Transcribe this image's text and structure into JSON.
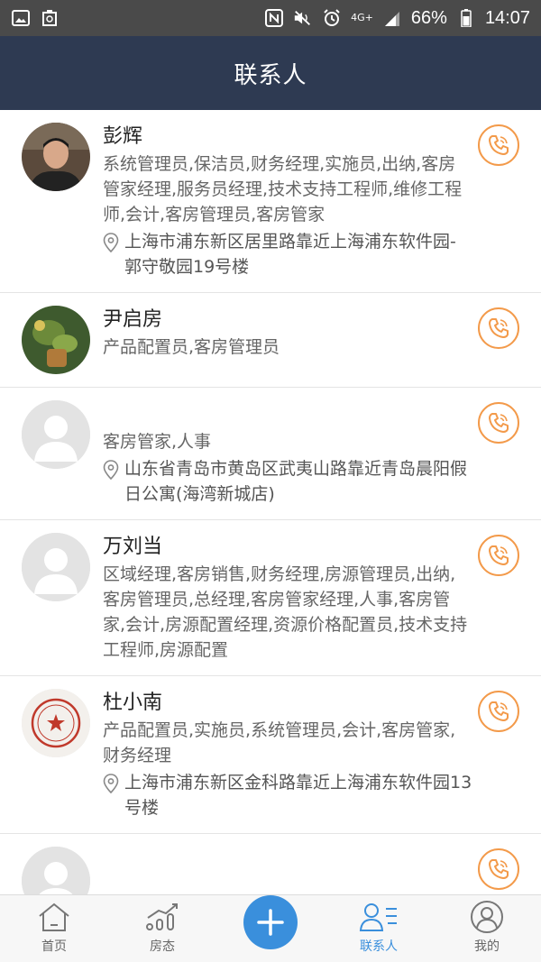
{
  "status_bar": {
    "battery": "66%",
    "time": "14:07",
    "network": "4G+"
  },
  "header": {
    "title": "联系人"
  },
  "contacts": [
    {
      "name": "彭辉",
      "roles": "系统管理员,保洁员,财务经理,实施员,出纳,客房管家经理,服务员经理,技术支持工程师,维修工程师,会计,客房管理员,客房管家",
      "address": "上海市浦东新区居里路靠近上海浦东软件园-郭守敬园19号楼"
    },
    {
      "name": "尹启房",
      "roles": "产品配置员,客房管理员",
      "address": ""
    },
    {
      "name": "",
      "roles": "客房管家,人事",
      "address": "山东省青岛市黄岛区武夷山路靠近青岛晨阳假日公寓(海湾新城店)"
    },
    {
      "name": "万刘当",
      "roles": "区域经理,客房销售,财务经理,房源管理员,出纳,客房管理员,总经理,客房管家经理,人事,客房管家,会计,房源配置经理,资源价格配置员,技术支持工程师,房源配置",
      "address": ""
    },
    {
      "name": "杜小南",
      "roles": "产品配置员,实施员,系统管理员,会计,客房管家,财务经理",
      "address": "上海市浦东新区金科路靠近上海浦东软件园13号楼"
    },
    {
      "name": "",
      "roles": "",
      "address": ""
    }
  ],
  "tabs": [
    {
      "label": "首页",
      "icon": "home-icon"
    },
    {
      "label": "房态",
      "icon": "room-status-icon"
    },
    {
      "label": "",
      "icon": "plus-icon"
    },
    {
      "label": "联系人",
      "icon": "contacts-icon",
      "active": true
    },
    {
      "label": "我的",
      "icon": "profile-icon"
    }
  ],
  "colors": {
    "header_bg": "#2e3a52",
    "accent": "#3a8fdc",
    "call_orange": "#f39a4a"
  }
}
